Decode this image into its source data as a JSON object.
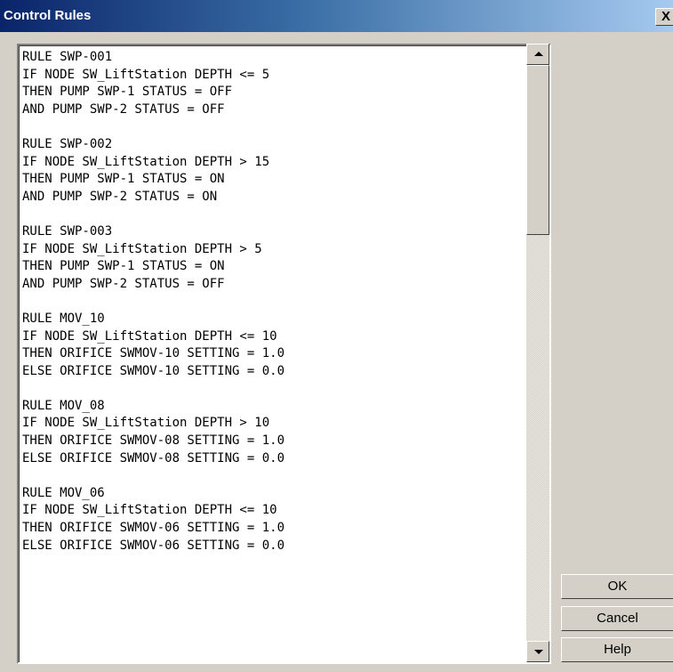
{
  "window": {
    "title": "Control Rules",
    "close_glyph": "X"
  },
  "rules_text": "RULE SWP-001\nIF NODE SW_LiftStation DEPTH <= 5\nTHEN PUMP SWP-1 STATUS = OFF\nAND PUMP SWP-2 STATUS = OFF\n\nRULE SWP-002\nIF NODE SW_LiftStation DEPTH > 15\nTHEN PUMP SWP-1 STATUS = ON\nAND PUMP SWP-2 STATUS = ON\n\nRULE SWP-003\nIF NODE SW_LiftStation DEPTH > 5\nTHEN PUMP SWP-1 STATUS = ON\nAND PUMP SWP-2 STATUS = OFF\n\nRULE MOV_10\nIF NODE SW_LiftStation DEPTH <= 10\nTHEN ORIFICE SWMOV-10 SETTING = 1.0\nELSE ORIFICE SWMOV-10 SETTING = 0.0\n\nRULE MOV_08\nIF NODE SW_LiftStation DEPTH > 10\nTHEN ORIFICE SWMOV-08 SETTING = 1.0\nELSE ORIFICE SWMOV-08 SETTING = 0.0\n\nRULE MOV_06\nIF NODE SW_LiftStation DEPTH <= 10\nTHEN ORIFICE SWMOV-06 SETTING = 1.0\nELSE ORIFICE SWMOV-06 SETTING = 0.0",
  "buttons": {
    "ok": "OK",
    "cancel": "Cancel",
    "help": "Help"
  },
  "icons": {
    "scroll_up": "scroll-up-arrow-icon",
    "scroll_down": "scroll-down-arrow-icon",
    "close": "close-icon"
  },
  "colors": {
    "title_gradient_start": "#0a246a",
    "title_gradient_end": "#a6caf0",
    "dialog_background": "#d4d0c8",
    "text_background": "#ffffff"
  }
}
